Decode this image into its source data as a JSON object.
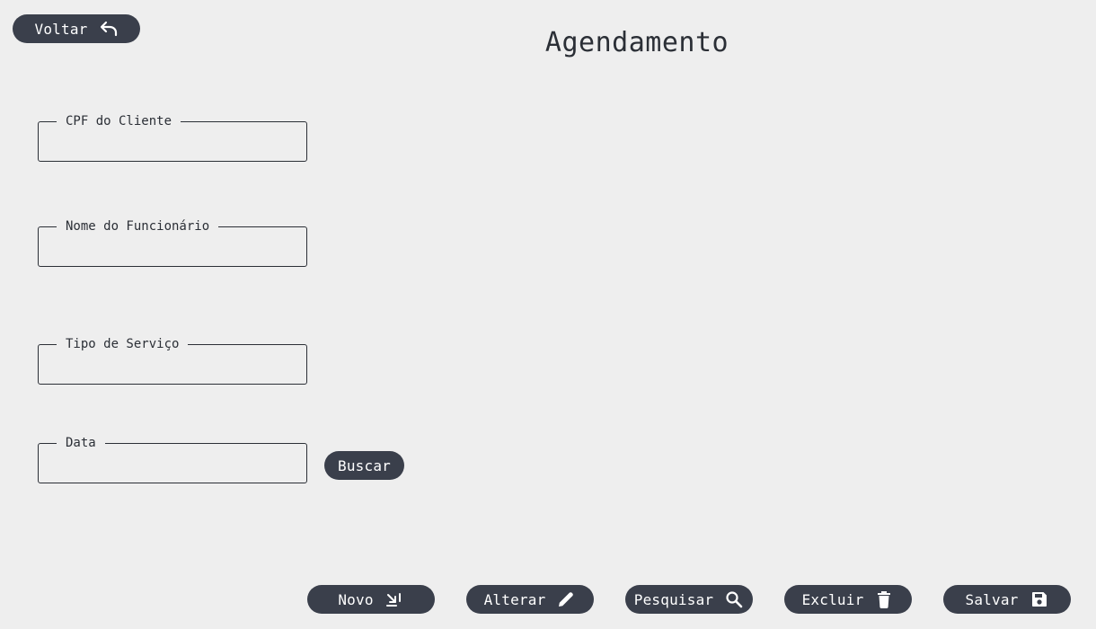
{
  "header": {
    "back_label": "Voltar",
    "title": "Agendamento"
  },
  "form": {
    "fields": [
      {
        "label": "CPF do Cliente",
        "value": "",
        "placeholder": ""
      },
      {
        "label": "Nome do Funcionário",
        "value": "",
        "placeholder": ""
      },
      {
        "label": "Tipo de Serviço",
        "value": "",
        "placeholder": ""
      },
      {
        "label": "Data",
        "value": "",
        "placeholder": ""
      }
    ],
    "search_label": "Buscar"
  },
  "actions": {
    "new_label": "Novo",
    "edit_label": "Alterar",
    "find_label": "Pesquisar",
    "delete_label": "Excluir",
    "save_label": "Salvar"
  },
  "icons": {
    "back": "undo-arrow-icon",
    "new": "new-entry-icon",
    "edit": "pencil-icon",
    "find": "magnifier-icon",
    "delete": "trash-icon",
    "save": "floppy-disk-icon"
  },
  "colors": {
    "background": "#eeeeee",
    "button": "#3a3f4b",
    "button_text": "#ffffff",
    "text": "#2b2f36"
  }
}
